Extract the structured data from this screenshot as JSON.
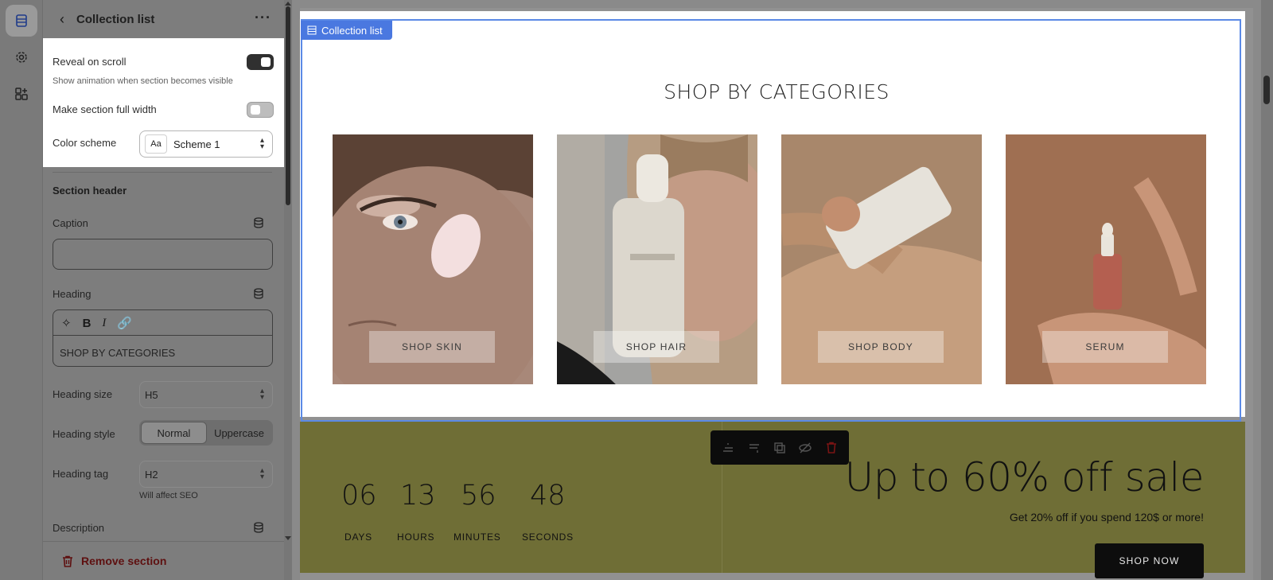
{
  "panel": {
    "title": "Collection list",
    "reveal_label": "Reveal on scroll",
    "reveal_sub": "Show animation when section becomes visible",
    "full_width_label": "Make section full width",
    "color_scheme_label": "Color scheme",
    "color_scheme_value": "Scheme 1",
    "color_scheme_icon_text": "Aa",
    "section_header": "Section header",
    "caption_label": "Caption",
    "caption_value": "",
    "heading_label": "Heading",
    "heading_value": "SHOP BY CATEGORIES",
    "heading_size_label": "Heading size",
    "heading_size_value": "H5",
    "heading_style_label": "Heading style",
    "heading_style_options": [
      "Normal",
      "Uppercase"
    ],
    "heading_tag_label": "Heading tag",
    "heading_tag_value": "H2",
    "heading_tag_hint": "Will affect SEO",
    "description_label": "Description",
    "remove_label": "Remove section"
  },
  "toggles": {
    "reveal_on_scroll": true,
    "full_width": false
  },
  "preview": {
    "selection_tag": "Collection list",
    "heading": "SHOP BY CATEGORIES",
    "cards": [
      {
        "label": "SHOP SKIN"
      },
      {
        "label": "SHOP HAIR"
      },
      {
        "label": "SHOP BODY"
      },
      {
        "label": "SERUM"
      }
    ],
    "countdown": [
      {
        "value": "06",
        "label": "DAYS"
      },
      {
        "value": "13",
        "label": "HOURS"
      },
      {
        "value": "56",
        "label": "MINUTES"
      },
      {
        "value": "48",
        "label": "SECONDS"
      }
    ],
    "sale_title": "Up to 60% off sale",
    "sale_sub": "Get 20% off if you spend 120$ or more!",
    "sale_button": "SHOP NOW"
  },
  "colors": {
    "accent": "#4a78e0",
    "remove": "#5e1010"
  }
}
